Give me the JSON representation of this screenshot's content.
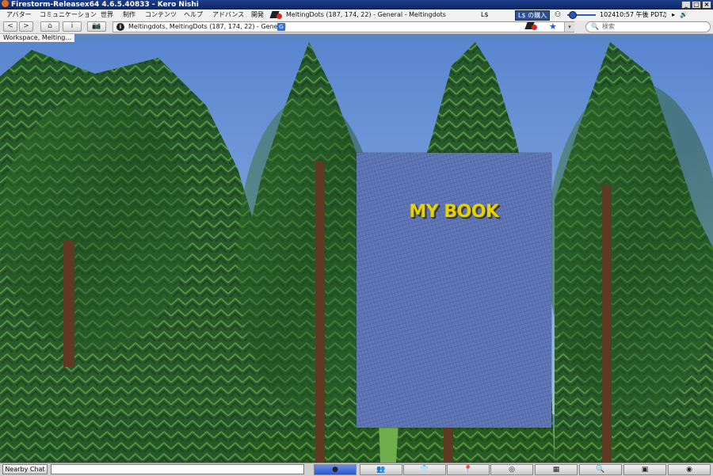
{
  "title_bar": {
    "text": "Firestorm-Releasex64 4.6.5.40833 - Kero Nishi"
  },
  "window_buttons": {
    "minimize": "_",
    "maximize": "□",
    "close": "×"
  },
  "menu": {
    "items": [
      {
        "label": "アバター"
      },
      {
        "label": "コミュニケーション"
      },
      {
        "label": "世界"
      },
      {
        "label": "制作"
      },
      {
        "label": "コンテンツ"
      },
      {
        "label": "ヘルプ"
      },
      {
        "label": "アドバンス"
      },
      {
        "label": "開発"
      }
    ],
    "location": "MeltingDots (187, 174, 22) - General - Meltingdots",
    "currency": "L$",
    "buy_currency": "L$ の購入",
    "fps": "1024",
    "clock": "10:57 午後 PDT",
    "media_icons": [
      "♫",
      "▸",
      "🔊"
    ]
  },
  "navigation": {
    "back": "<",
    "forward": ">",
    "home": "⌂",
    "info": "i",
    "camera": "📷",
    "location_field": "Meltingdots, MeltingDots (187, 174, 22) - General",
    "rating_badge": "G",
    "dropdown": "▾",
    "search_placeholder": "検索"
  },
  "breadcrumb": {
    "text": "Workspace, Melting..."
  },
  "scene": {
    "book_title": "MY BOOK"
  },
  "bottom_bar": {
    "chat_button": "Nearby Chat",
    "toolbar": [
      {
        "name": "conversations",
        "glyph": "●"
      },
      {
        "name": "people",
        "glyph": "👥"
      },
      {
        "name": "appearance",
        "glyph": "👕"
      },
      {
        "name": "places",
        "glyph": "📍"
      },
      {
        "name": "radar",
        "glyph": "◎"
      },
      {
        "name": "world-map",
        "glyph": "▦"
      },
      {
        "name": "search",
        "glyph": "🔍"
      },
      {
        "name": "inventory",
        "glyph": "▣"
      },
      {
        "name": "help",
        "glyph": "◉"
      }
    ]
  },
  "colors": {
    "accent": "#2b56c8",
    "book_cover": "#5b72b4",
    "book_title": "#e6d200"
  }
}
